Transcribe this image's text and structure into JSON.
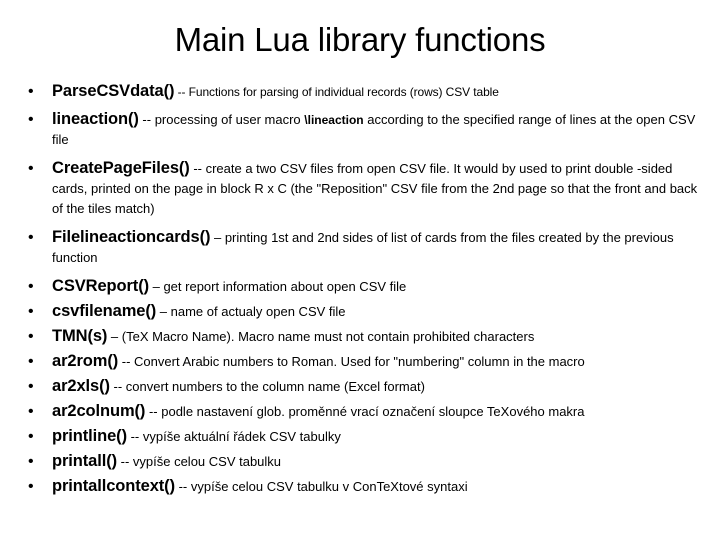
{
  "slide": {
    "title": "Main Lua library functions",
    "bullet_glyph": "•"
  },
  "items": [
    {
      "name": "ParseCSVdata()",
      "sep": " -- ",
      "desc": "Functions for parsing of individual records (rows) CSV table"
    },
    {
      "name": "lineaction()",
      "sep": " -- ",
      "desc_pre": "processing of user macro ",
      "desc_em": "\\lineaction",
      "desc_post": " according to the specified range of lines at the open CSV file"
    },
    {
      "name": "CreatePageFiles()",
      "sep": " -- ",
      "desc": "create a two CSV files from open CSV file. It would by used to print double -sided cards, printed on the page in block R x C (the \"Reposition\" CSV file from the 2nd page so that the front and back of the tiles match)"
    },
    {
      "name": "Filelineactioncards()",
      "sep": " – ",
      "desc": "printing 1st and 2nd  sides of list of cards from the files created by the previous function"
    },
    {
      "name": "CSVReport()",
      "sep": " – ",
      "desc": "get report information about open CSV file"
    },
    {
      "name": "csvfilename()",
      "sep": " – ",
      "desc": "name of actualy open CSV file"
    },
    {
      "name": "TMN(s)",
      "sep": " – ",
      "desc": "(TeX Macro Name). Macro name must not contain prohibited characters"
    },
    {
      "name": "ar2rom()",
      "sep": " -- ",
      "desc": "Convert Arabic numbers to Roman. Used for \"numbering\" column in the macro"
    },
    {
      "name": "ar2xls()",
      "sep": " -- ",
      "desc": "convert numbers to the column name (Excel format)"
    },
    {
      "name": "ar2colnum()",
      "sep": " -- ",
      "desc": "podle nastavení glob. proměnné vrací označení sloupce TeXového makra"
    },
    {
      "name": "printline()",
      "sep": " -- ",
      "desc": "vypíše aktuální řádek CSV tabulky"
    },
    {
      "name": "printall()",
      "sep": " -- ",
      "desc": "vypíše celou CSV tabulku"
    },
    {
      "name": "printallcontext()",
      "sep": " -- ",
      "desc": "vypíše celou CSV tabulku v ConTeXtové syntaxi"
    }
  ]
}
